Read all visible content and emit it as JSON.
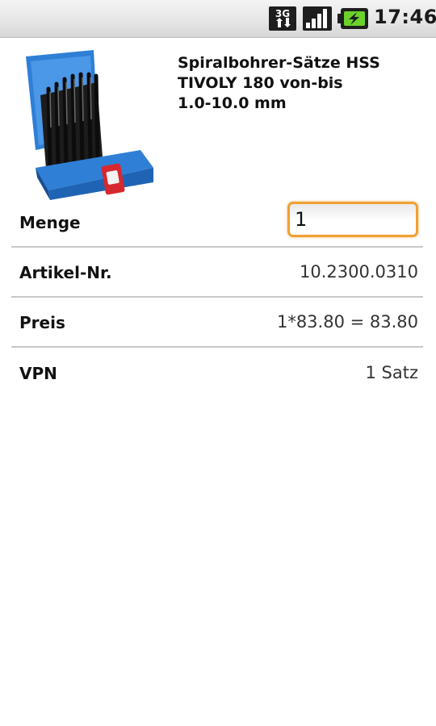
{
  "status_bar": {
    "network_label": "3G",
    "time": "17:46",
    "icons": [
      "3g-icon",
      "signal-icon",
      "battery-charging-icon"
    ]
  },
  "product": {
    "title": "Spiralbohrer-Sätze HSS\nTIVOLY 180 von-bis\n1.0-10.0 mm",
    "image_icon": "drill-set-case-icon"
  },
  "details": {
    "quantity": {
      "label": "Menge",
      "value": "1"
    },
    "article": {
      "label": "Artikel-Nr.",
      "value": "10.2300.0310"
    },
    "price": {
      "label": "Preis",
      "value": "1*83.80 = 83.80"
    },
    "vpn": {
      "label": "VPN",
      "value": "1 Satz"
    }
  },
  "colors": {
    "input_focus_border": "#f0a033",
    "case_blue": "#2f7fd6",
    "divider": "#c8c8c8"
  }
}
